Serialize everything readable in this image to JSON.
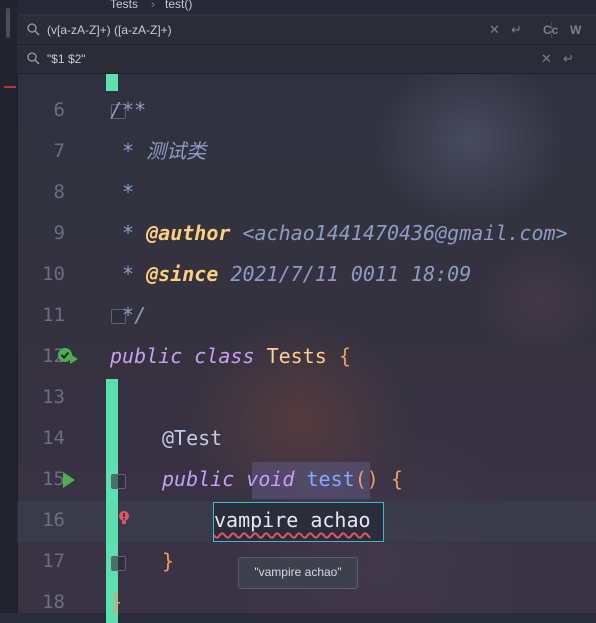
{
  "breadcrumb": {
    "items": [
      "Tests",
      "test()"
    ]
  },
  "find_bar": {
    "value": "(v[a-zA-Z]+) ([a-zA-Z]+)",
    "case_option": "Cc",
    "word_option": "W"
  },
  "replace_bar": {
    "value": "\"$1 $2\""
  },
  "line_numbers": [
    "6",
    "7",
    "8",
    "9",
    "10",
    "11",
    "12",
    "13",
    "14",
    "15",
    "16",
    "17",
    "18"
  ],
  "code": {
    "l6": "/**",
    "l7": " * 测试类",
    "l8": " *",
    "l9_star": " * ",
    "l9_tag": "@author",
    "l9_text": " <achao1441470436@gmail.com>",
    "l10_star": " * ",
    "l10_tag": "@since",
    "l10_text": " 2021/7/11 0011 18:09",
    "l11": " */",
    "l12_kw1": "public",
    "l12_kw2": "class",
    "l12_name": "Tests",
    "l12_brace": "{",
    "l14": "@Test",
    "l15_kw1": "public",
    "l15_kw2": "void",
    "l15_fn": "test",
    "l15_paren": "()",
    "l15_brace": "{",
    "l16": "vampire achao",
    "l17": "}",
    "l18": "}"
  },
  "tooltip": {
    "text": "\"vampire achao\""
  },
  "colors": {
    "vcs_added": "#5be0b2",
    "run_icon": "#4caf50",
    "error_icon": "#e05561",
    "selection_border": "#3fb9c9"
  }
}
